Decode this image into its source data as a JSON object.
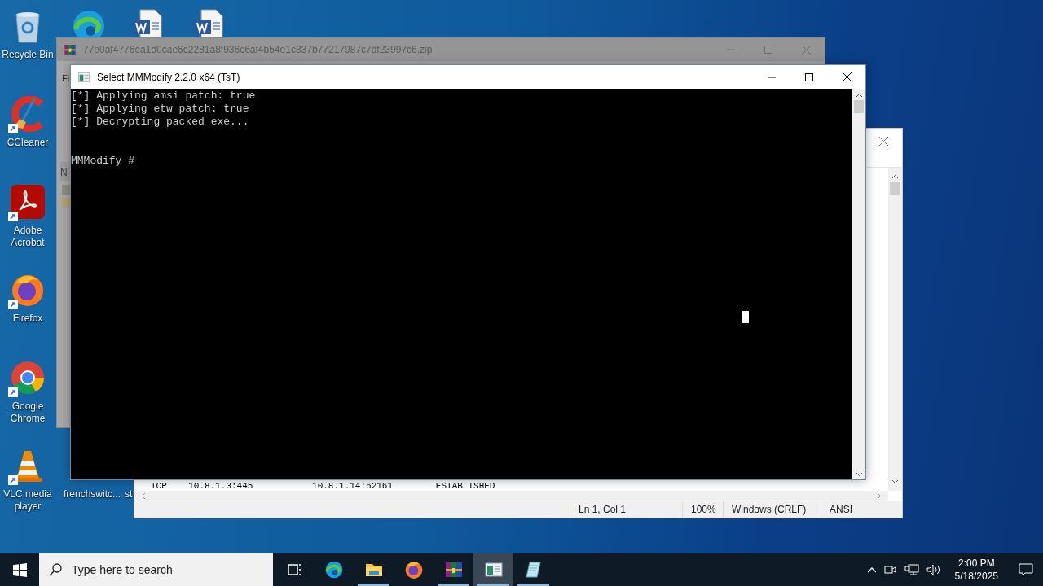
{
  "desktop_icons": [
    {
      "kind": "recycle-bin",
      "label": "Recycle Bin",
      "shortcut": false
    },
    {
      "kind": "edge",
      "shortcut": false
    },
    {
      "kind": "word-doc",
      "shortcut": false
    },
    {
      "kind": "word-doc",
      "shortcut": false
    },
    {
      "kind": "ccleaner",
      "label": "CCleaner",
      "shortcut": true
    },
    {
      "kind": "acrobat",
      "label": "Adobe Acrobat",
      "shortcut": true
    },
    {
      "kind": "firefox",
      "label": "Firefox",
      "shortcut": true
    },
    {
      "kind": "chrome",
      "label": "Google Chrome",
      "shortcut": true
    },
    {
      "kind": "vlc",
      "label": "VLC media player",
      "shortcut": true
    },
    {
      "kind": "file",
      "label": "frenchswitc...",
      "shortcut": false
    },
    {
      "kind": "file",
      "label": "st",
      "shortcut": false
    }
  ],
  "archive_window": {
    "title": "77e0af4776ea1d0cae6c2281a8f936c6af4b54e1c337b77217987c7df23997c6.zip",
    "menu_fragment": "Fi",
    "column_fragment": "N"
  },
  "notepad_window": {
    "lines": [
      "TCP    10.8.1.3:445           10.8.1.14:62161        ESTABLISHED"
    ],
    "status": [
      "Ln 1, Col 1",
      "100%",
      "Windows (CRLF)",
      "ANSI"
    ]
  },
  "console_window": {
    "title": "Select MMModify 2.2.0 x64 (TsT)",
    "lines": [
      "[*] Applying amsi patch: true",
      "[*] Applying etw patch: true",
      "[*] Decrypting packed exe..."
    ],
    "prompt": "MMModify #"
  },
  "taskbar": {
    "search": {
      "placeholder": "Type here to search"
    },
    "apps": [
      {
        "kind": "task-view",
        "active": false,
        "running": false
      },
      {
        "kind": "edge",
        "active": false,
        "running": false
      },
      {
        "kind": "explorer",
        "active": false,
        "running": true
      },
      {
        "kind": "firefox",
        "active": false,
        "running": false
      },
      {
        "kind": "winrar",
        "active": false,
        "running": true
      },
      {
        "kind": "console",
        "active": true,
        "running": true
      },
      {
        "kind": "notepad",
        "active": false,
        "running": true
      }
    ],
    "time": "2:00 PM",
    "date": "5/18/2025"
  }
}
